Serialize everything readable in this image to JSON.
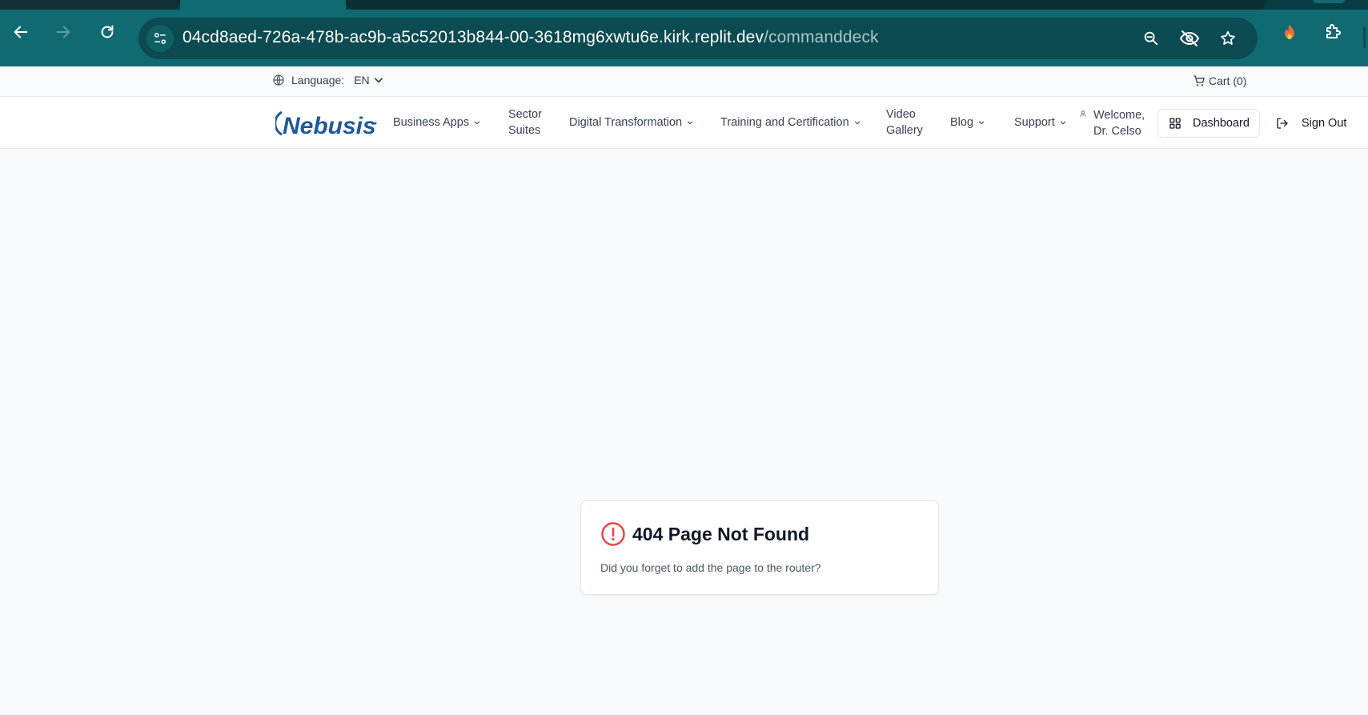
{
  "browser": {
    "url_host": "04cd8aed-726a-478b-ac9b-a5c52013b844-00-3618mg6xwtu6e.kirk.replit.dev",
    "url_path": "/commanddeck",
    "icons": [
      "back-icon",
      "forward-icon",
      "reload-icon",
      "site-settings-icon",
      "zoom-icon",
      "eye-off-icon",
      "star-icon",
      "extension-flame-icon",
      "extensions-icon"
    ]
  },
  "topbar": {
    "language_label": "Language:",
    "language_value": "EN",
    "cart_label": "Cart (0)"
  },
  "nav": {
    "logo_text": "Nebusis",
    "business_apps": "Business Apps",
    "sector_line1": "Sector",
    "sector_line2": "Suites",
    "digital_transformation": "Digital Transformation",
    "training": "Training and Certification",
    "video_line1": "Video",
    "video_line2": "Gallery",
    "blog": "Blog",
    "support": "Support",
    "welcome_line1": "Welcome,",
    "welcome_line2": "Dr. Celso",
    "dashboard": "Dashboard",
    "sign_out": "Sign Out"
  },
  "error": {
    "title": "404 Page Not Found",
    "message": "Did you forget to add the page to the router?"
  },
  "colors": {
    "chrome": "#0f6b71",
    "brand": "#1e5a99",
    "error_red": "#ef4444"
  }
}
